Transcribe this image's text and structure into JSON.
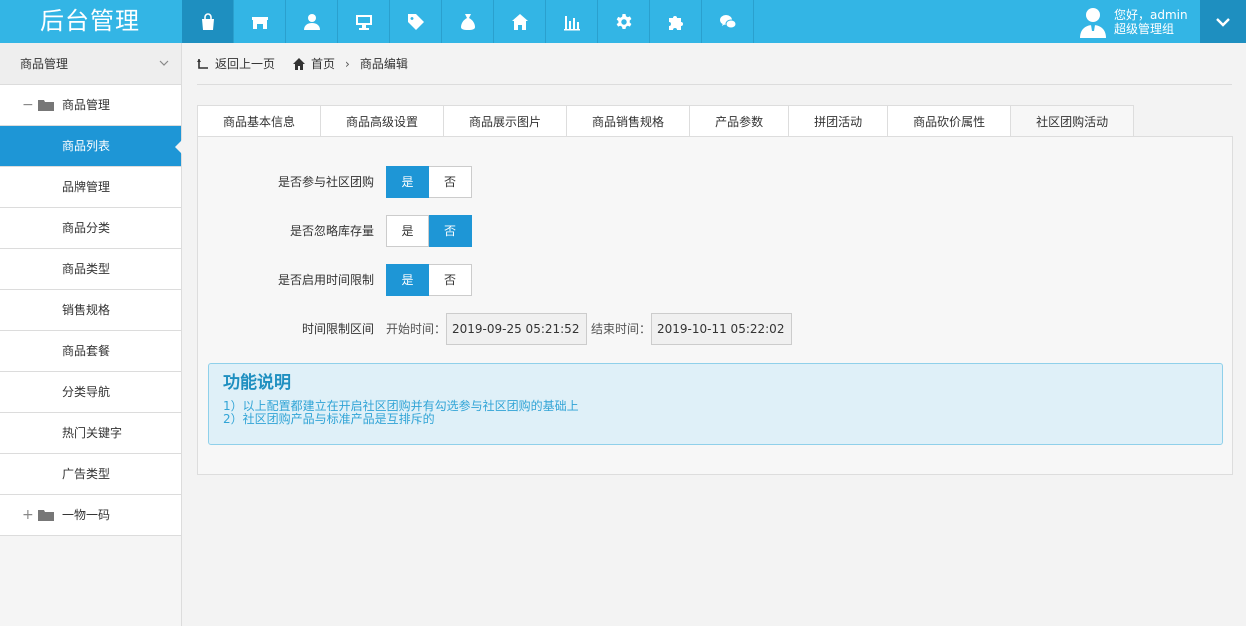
{
  "header": {
    "brand": "后台管理",
    "nav_icons": [
      "shopping-bag-icon",
      "store-icon",
      "user-icon",
      "monitor-icon",
      "tag-icon",
      "money-bag-icon",
      "home-icon",
      "bar-chart-icon",
      "gear-icon",
      "puzzle-icon",
      "wechat-icon"
    ],
    "greeting": "您好，admin",
    "role": "超级管理组",
    "bg_color": "#33b5e5"
  },
  "sidebar": {
    "title": "商品管理",
    "group1": "商品管理",
    "items": [
      "商品列表",
      "品牌管理",
      "商品分类",
      "商品类型",
      "销售规格",
      "商品套餐",
      "分类导航",
      "热门关键字",
      "广告类型"
    ],
    "group2": "一物一码"
  },
  "breadcrumb": {
    "back": "返回上一页",
    "home": "首页",
    "current": "商品编辑"
  },
  "tabs": [
    "商品基本信息",
    "商品高级设置",
    "商品展示图片",
    "商品销售规格",
    "产品参数",
    "拼团活动",
    "商品砍价属性",
    "社区团购活动"
  ],
  "form": {
    "join_label": "是否参与社区团购",
    "ignore_stock_label": "是否忽略库存量",
    "time_limit_label": "是否启用时间限制",
    "yes": "是",
    "no": "否",
    "range_label": "时间限制区间",
    "start_label": "开始时间：",
    "start_value": "2019-09-25 05:21:52",
    "end_label": "结束时间：",
    "end_value": "2019-10-11 05:22:02"
  },
  "info": {
    "title": "功能说明",
    "line1": "1）以上配置都建立在开启社区团购并有勾选参与社区团购的基础上",
    "line2": "2）社区团购产品与标准产品是互排斥的"
  }
}
